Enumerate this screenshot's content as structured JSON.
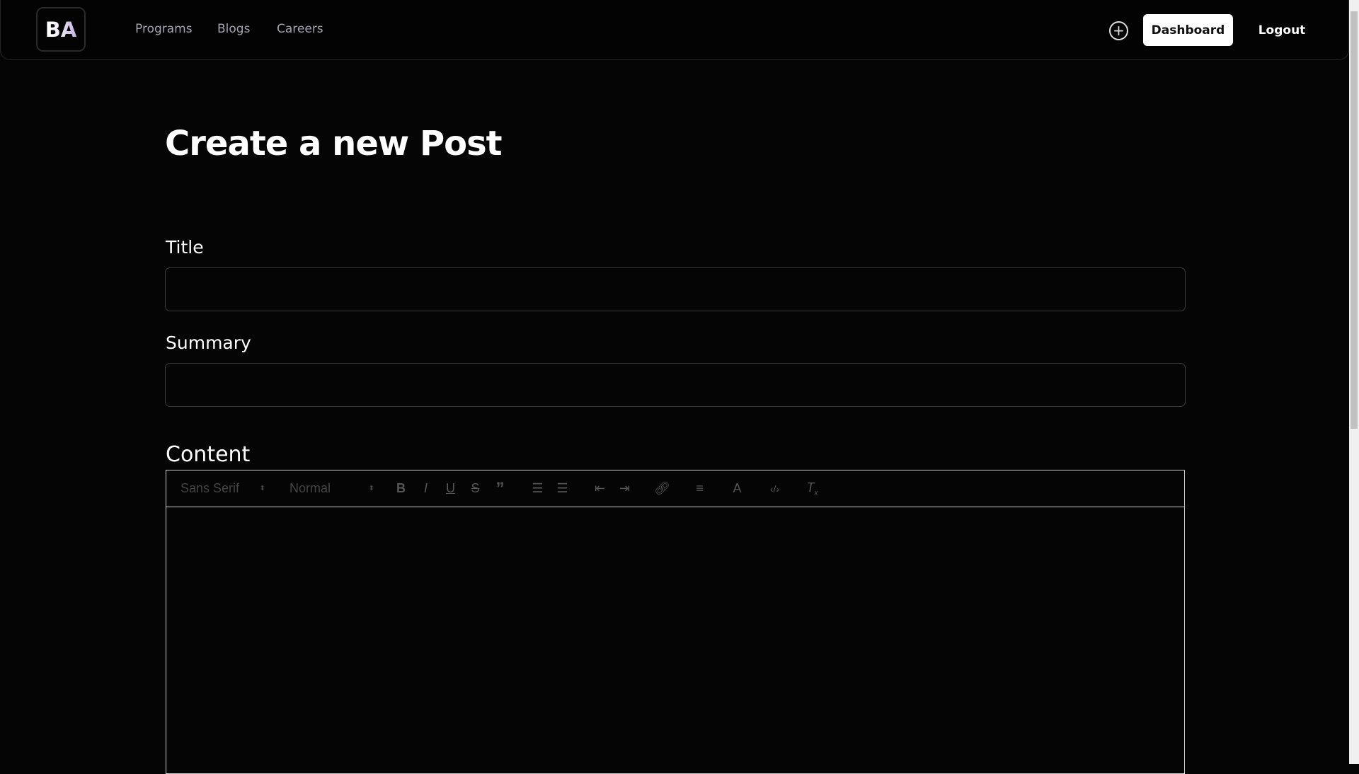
{
  "nav": {
    "logo": "BA",
    "links": [
      "Programs",
      "Blogs",
      "Careers"
    ],
    "dashboard": "Dashboard",
    "logout": "Logout"
  },
  "page": {
    "title": "Create a new Post"
  },
  "form": {
    "title_label": "Title",
    "title_value": "",
    "summary_label": "Summary",
    "summary_value": "",
    "content_label": "Content"
  },
  "toolbar": {
    "font": "Sans Serif",
    "size": "Normal"
  }
}
